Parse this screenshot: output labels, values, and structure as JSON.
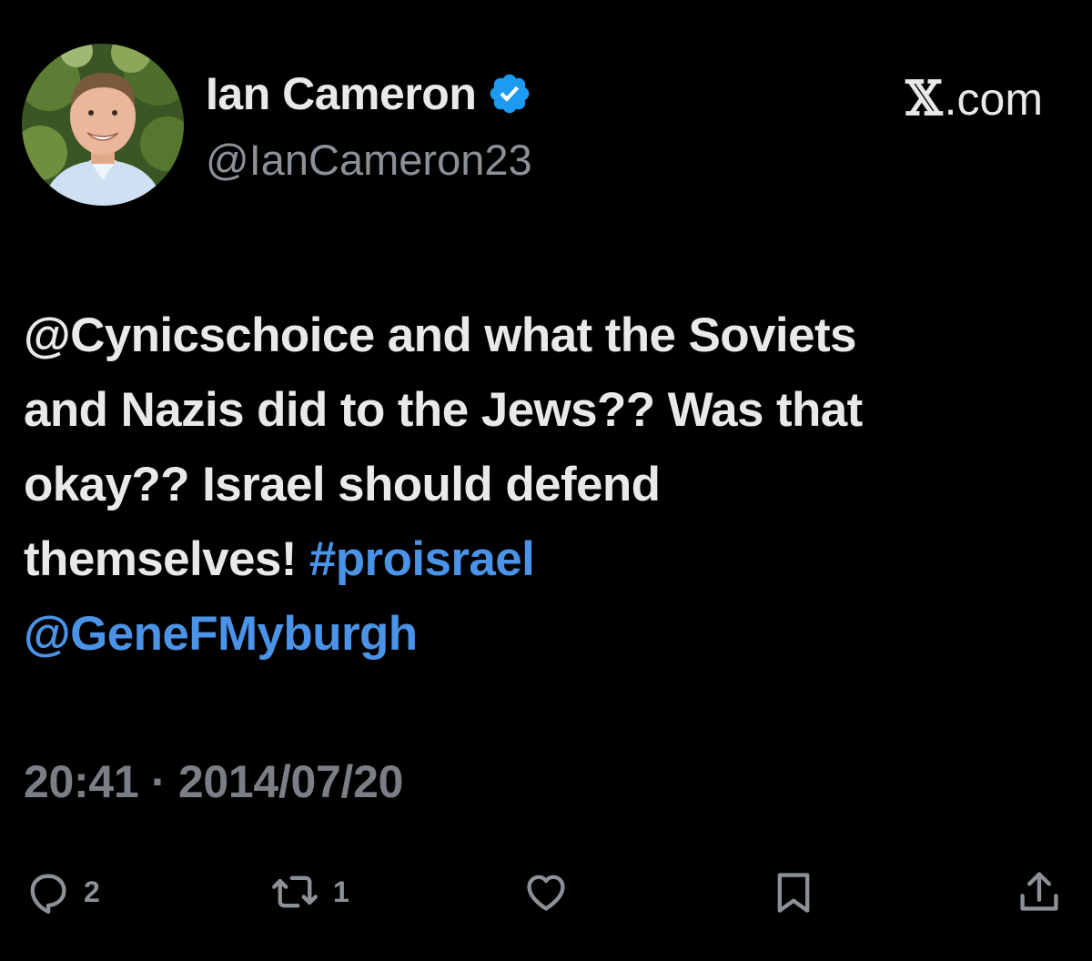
{
  "profile": {
    "display_name": "Ian Cameron",
    "handle": "@IanCameron23",
    "verified_icon": "verified-badge-icon",
    "avatar_icon": "profile-photo"
  },
  "brand": {
    "label": ".com",
    "mark": "𝕏"
  },
  "tweet": {
    "text_lines": [
      "@Cynicschoice and what the Soviets",
      "and Nazis did to the Jews?? Was that",
      "okay?? Israel should defend",
      "themselves! "
    ],
    "hashtag": "#proisrael",
    "mention": "@GeneFMyburgh",
    "link_color": "#4a93e6"
  },
  "meta": {
    "timestamp": "20:41 · 2014/07/20"
  },
  "actions": {
    "reply": {
      "icon": "reply-icon",
      "count": "2"
    },
    "retweet": {
      "icon": "retweet-icon",
      "count": "1"
    },
    "like": {
      "icon": "heart-icon"
    },
    "bookmark": {
      "icon": "bookmark-icon"
    },
    "share": {
      "icon": "share-icon"
    }
  },
  "colors": {
    "background": "#000000",
    "text": "#e7e9ea",
    "secondary": "#8b9196",
    "accent": "#1d9bf0"
  }
}
